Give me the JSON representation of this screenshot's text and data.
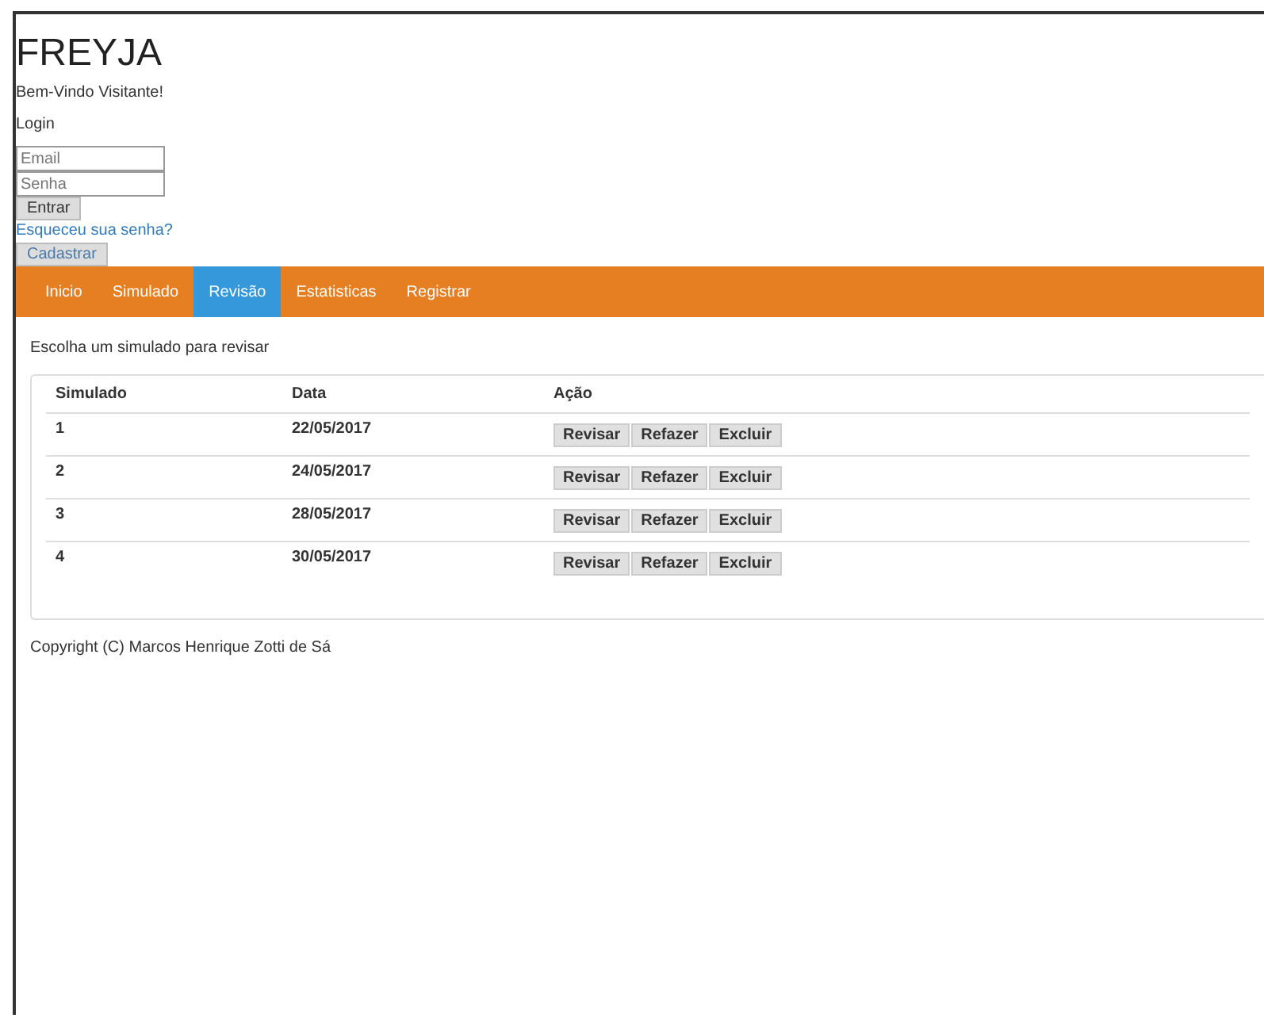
{
  "header": {
    "title": "FREYJA",
    "welcome": "Bem-Vindo Visitante!"
  },
  "login": {
    "heading": "Login",
    "email": {
      "placeholder": "Email"
    },
    "password": {
      "placeholder": "Senha"
    },
    "submit": "Entrar",
    "forgot": "Esqueceu sua senha?",
    "register": "Cadastrar"
  },
  "nav": [
    {
      "label": "Inicio",
      "selected": false
    },
    {
      "label": "Simulado",
      "selected": false
    },
    {
      "label": "Revisão",
      "selected": true
    },
    {
      "label": "Estatisticas",
      "selected": false
    },
    {
      "label": "Registrar",
      "selected": false
    }
  ],
  "intro": "Escolha um simulado para revisar",
  "table": {
    "columns": [
      "Simulado",
      "Data",
      "Ação"
    ],
    "rows": [
      {
        "simulado": "1",
        "data": "22/05/2017",
        "actions": [
          "Revisar",
          "Refazer",
          "Excluir"
        ]
      },
      {
        "simulado": "2",
        "data": "24/05/2017",
        "actions": [
          "Revisar",
          "Refazer",
          "Excluir"
        ]
      },
      {
        "simulado": "3",
        "data": "28/05/2017",
        "actions": [
          "Revisar",
          "Refazer",
          "Excluir"
        ]
      },
      {
        "simulado": "4",
        "data": "30/05/2017",
        "actions": [
          "Revisar",
          "Refazer",
          "Excluir"
        ]
      }
    ]
  },
  "footer": "Copyright (C) Marcos Henrique Zotti de Sá"
}
